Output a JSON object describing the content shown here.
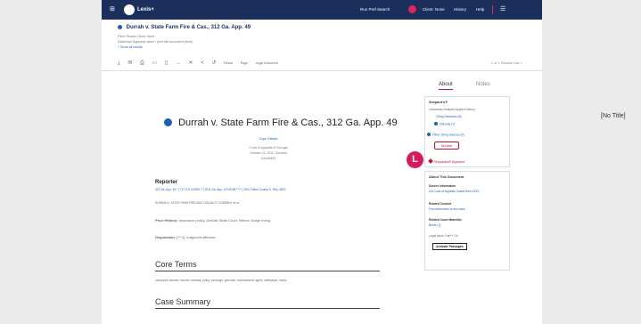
{
  "topbar": {
    "grid_icon": "grid-icon",
    "logo": "Lexis+",
    "nav": [
      "Run Pref Search",
      "Client: None",
      "History",
      "Help"
    ]
  },
  "doc_header": {
    "title": "Durrah v. State Farm Fire & Cas., 312 Ga. App. 49",
    "sub1": "Field: Reader   Client: None",
    "sub2": "Additional Signposts when I print this document (shell)",
    "sub3": "+ Show all results",
    "toolbar_icons": [
      "download-icon",
      "email-icon",
      "print-icon",
      "folder-icon",
      "save-icon",
      "arrow-icon",
      "close-icon",
      "share-icon",
      "history-icon"
    ],
    "toolbar_labels": [
      "Result",
      "Page",
      "Legal Document"
    ],
    "page_ctrl": "1 of 1   Results List >"
  },
  "doc": {
    "title": "Durrah v. State Farm Fire & Cas., 312 Ga. App. 49",
    "copy_citation": "Copy Citation",
    "court": "Court of Appeals of Georgia",
    "dates": "October 24, 2011, Decided",
    "docket": "A11A0954",
    "reporter_head": "Reporter",
    "reporter_line": "312 Ga. App. 49 *  |  717 S.E.2d 555 **  |  2011 Ga. App. LEXIS 867 ***  |  2011 Fulton County D. Rep. 3570",
    "parties_line": "DURRAH v. STATE FARM FIRE AND CASUALTY COMPANY et al.",
    "prior_label": "Prior History:",
    "prior_text": "Insurance policy. DeKalb State Court. Before Judge Irving.",
    "disposition_label": "Disposition:",
    "disposition_text": "[***1] Judgment affirmed.",
    "core_terms_head": "Core Terms",
    "core_terms_text": "uninsured motorist, insured, renewal, policy, coverage, premium, endorsement, agent, notification, notice",
    "case_summary_head": "Case Summary"
  },
  "sidebar": {
    "tab_about": "About",
    "tab_notes": "Notes",
    "shepards_head": "Shepard's®",
    "shepards_line": "Cautionary Analysis Applied History",
    "citing_decisions": "Citing Decisions (8)",
    "cited_by": "Cited By (7)",
    "other_sources": "Other Citing Sources (9)",
    "alert_btn": "Set Alert",
    "shep_approval": "Shepardize® Approved",
    "about_doc": "About This Document",
    "source_label": "Source Information",
    "source_value": "GA Court of Appeals Cases from 1933",
    "related_label": "Related Content",
    "related_value": "Find references to this case",
    "related_court": "Related Court Materials",
    "briefs": "Briefs (1)",
    "legal_issue": "Legal Issue Trail™  On",
    "activate_btn": "Activate Passages"
  },
  "overlay": {
    "badge": "L",
    "no_title": "[No Title]"
  }
}
